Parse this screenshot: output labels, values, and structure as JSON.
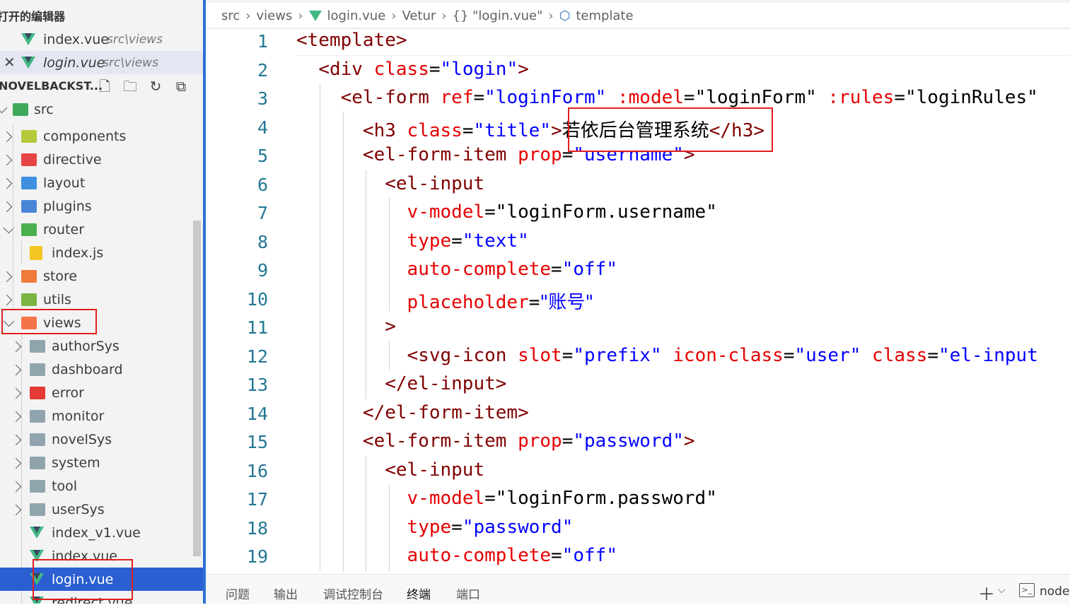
{
  "sidebar": {
    "open_editors_title": "打开的编辑器",
    "open_editors": [
      {
        "name": "index.vue",
        "path": "src\\views"
      },
      {
        "name": "login.vue",
        "path": "src\\views"
      }
    ],
    "project_title": "NOVELBACKST...",
    "toolbar_icons": [
      "new-file-icon",
      "new-folder-icon",
      "refresh-icon",
      "collapse-all-icon"
    ],
    "tree": [
      {
        "label": "src",
        "icon": "folder-src-icon",
        "expanded": true
      },
      {
        "label": "components",
        "icon": "folder-components-icon",
        "expanded": false
      },
      {
        "label": "directive",
        "icon": "folder-directive-icon",
        "expanded": false
      },
      {
        "label": "layout",
        "icon": "folder-layout-icon",
        "expanded": false
      },
      {
        "label": "plugins",
        "icon": "folder-plugins-icon",
        "expanded": false
      },
      {
        "label": "router",
        "icon": "folder-router-icon",
        "expanded": true
      },
      {
        "label": "index.js",
        "icon": "js-file-icon"
      },
      {
        "label": "store",
        "icon": "folder-store-icon",
        "expanded": false
      },
      {
        "label": "utils",
        "icon": "folder-utils-icon",
        "expanded": false
      },
      {
        "label": "views",
        "icon": "folder-views-icon",
        "expanded": true
      },
      {
        "label": "authorSys",
        "icon": "folder-icon",
        "expanded": false
      },
      {
        "label": "dashboard",
        "icon": "folder-icon",
        "expanded": false
      },
      {
        "label": "error",
        "icon": "folder-error-icon",
        "expanded": false
      },
      {
        "label": "monitor",
        "icon": "folder-icon",
        "expanded": false
      },
      {
        "label": "novelSys",
        "icon": "folder-icon",
        "expanded": false
      },
      {
        "label": "system",
        "icon": "folder-icon",
        "expanded": false
      },
      {
        "label": "tool",
        "icon": "folder-icon",
        "expanded": false
      },
      {
        "label": "userSys",
        "icon": "folder-icon",
        "expanded": false
      },
      {
        "label": "index_v1.vue",
        "icon": "vue-file-icon"
      },
      {
        "label": "index.vue",
        "icon": "vue-file-icon"
      },
      {
        "label": "login.vue",
        "icon": "vue-file-icon",
        "selected": true
      },
      {
        "label": "redirect.vue",
        "icon": "vue-file-icon"
      }
    ]
  },
  "breadcrumb": [
    "src",
    "views",
    "login.vue",
    "Vetur",
    "{} \"login.vue\"",
    "template"
  ],
  "code_lines": [
    {
      "n": "1",
      "tokens": [
        {
          "t": "<template>",
          "c": "tag"
        }
      ]
    },
    {
      "n": "2",
      "tokens": [
        {
          "t": "  "
        },
        {
          "t": "<div ",
          "c": "tag"
        },
        {
          "t": "class",
          "c": "attr"
        },
        {
          "t": "=",
          "c": "plain"
        },
        {
          "t": "\"login\"",
          "c": "str"
        },
        {
          "t": ">",
          "c": "tag"
        }
      ]
    },
    {
      "n": "3",
      "tokens": [
        {
          "t": "    "
        },
        {
          "t": "<el-form ",
          "c": "tag"
        },
        {
          "t": "ref",
          "c": "attr"
        },
        {
          "t": "=",
          "c": "plain"
        },
        {
          "t": "\"loginForm\"",
          "c": "str"
        },
        {
          "t": " "
        },
        {
          "t": ":model",
          "c": "attr"
        },
        {
          "t": "=",
          "c": "plain"
        },
        {
          "t": "\"loginForm\"",
          "c": "plain"
        },
        {
          "t": " "
        },
        {
          "t": ":rules",
          "c": "attr"
        },
        {
          "t": "=",
          "c": "plain"
        },
        {
          "t": "\"loginRules\"",
          "c": "plain"
        }
      ]
    },
    {
      "n": "4",
      "tokens": [
        {
          "t": "      "
        },
        {
          "t": "<h3 ",
          "c": "tag"
        },
        {
          "t": "class",
          "c": "attr"
        },
        {
          "t": "=",
          "c": "plain"
        },
        {
          "t": "\"title\"",
          "c": "str"
        },
        {
          "t": ">",
          "c": "tag"
        },
        {
          "t": "若依后台管理系统",
          "c": "plain",
          "cjk": true
        },
        {
          "t": "</h3>",
          "c": "tag"
        }
      ]
    },
    {
      "n": "5",
      "tokens": [
        {
          "t": "      "
        },
        {
          "t": "<el-form-item ",
          "c": "tag"
        },
        {
          "t": "prop",
          "c": "attr"
        },
        {
          "t": "=",
          "c": "plain"
        },
        {
          "t": "\"username\"",
          "c": "str"
        },
        {
          "t": ">",
          "c": "tag"
        }
      ]
    },
    {
      "n": "6",
      "tokens": [
        {
          "t": "        "
        },
        {
          "t": "<el-input",
          "c": "tag"
        }
      ]
    },
    {
      "n": "7",
      "tokens": [
        {
          "t": "          "
        },
        {
          "t": "v-model",
          "c": "attr"
        },
        {
          "t": "=",
          "c": "plain"
        },
        {
          "t": "\"loginForm.username\"",
          "c": "plain"
        }
      ]
    },
    {
      "n": "8",
      "tokens": [
        {
          "t": "          "
        },
        {
          "t": "type",
          "c": "attr"
        },
        {
          "t": "=",
          "c": "plain"
        },
        {
          "t": "\"text\"",
          "c": "str"
        }
      ]
    },
    {
      "n": "9",
      "tokens": [
        {
          "t": "          "
        },
        {
          "t": "auto-complete",
          "c": "attr"
        },
        {
          "t": "=",
          "c": "plain"
        },
        {
          "t": "\"off\"",
          "c": "str"
        }
      ]
    },
    {
      "n": "10",
      "tokens": [
        {
          "t": "          "
        },
        {
          "t": "placeholder",
          "c": "attr"
        },
        {
          "t": "=",
          "c": "plain"
        },
        {
          "t": "\"账号\"",
          "c": "str",
          "cjk": true
        }
      ]
    },
    {
      "n": "11",
      "tokens": [
        {
          "t": "        "
        },
        {
          "t": ">",
          "c": "tag"
        }
      ]
    },
    {
      "n": "12",
      "tokens": [
        {
          "t": "          "
        },
        {
          "t": "<svg-icon ",
          "c": "tag"
        },
        {
          "t": "slot",
          "c": "attr"
        },
        {
          "t": "=",
          "c": "plain"
        },
        {
          "t": "\"prefix\"",
          "c": "str"
        },
        {
          "t": " "
        },
        {
          "t": "icon-class",
          "c": "attr"
        },
        {
          "t": "=",
          "c": "plain"
        },
        {
          "t": "\"user\"",
          "c": "str"
        },
        {
          "t": " "
        },
        {
          "t": "class",
          "c": "attr"
        },
        {
          "t": "=",
          "c": "plain"
        },
        {
          "t": "\"el-input",
          "c": "str"
        }
      ]
    },
    {
      "n": "13",
      "tokens": [
        {
          "t": "        "
        },
        {
          "t": "</el-input>",
          "c": "tag"
        }
      ]
    },
    {
      "n": "14",
      "tokens": [
        {
          "t": "      "
        },
        {
          "t": "</el-form-item>",
          "c": "tag"
        }
      ]
    },
    {
      "n": "15",
      "tokens": [
        {
          "t": "      "
        },
        {
          "t": "<el-form-item ",
          "c": "tag"
        },
        {
          "t": "prop",
          "c": "attr"
        },
        {
          "t": "=",
          "c": "plain"
        },
        {
          "t": "\"password\"",
          "c": "str"
        },
        {
          "t": ">",
          "c": "tag"
        }
      ]
    },
    {
      "n": "16",
      "tokens": [
        {
          "t": "        "
        },
        {
          "t": "<el-input",
          "c": "tag"
        }
      ]
    },
    {
      "n": "17",
      "tokens": [
        {
          "t": "          "
        },
        {
          "t": "v-model",
          "c": "attr"
        },
        {
          "t": "=",
          "c": "plain"
        },
        {
          "t": "\"loginForm.password\"",
          "c": "plain"
        }
      ]
    },
    {
      "n": "18",
      "tokens": [
        {
          "t": "          "
        },
        {
          "t": "type",
          "c": "attr"
        },
        {
          "t": "=",
          "c": "plain"
        },
        {
          "t": "\"password\"",
          "c": "str"
        }
      ]
    },
    {
      "n": "19",
      "tokens": [
        {
          "t": "          "
        },
        {
          "t": "auto-complete",
          "c": "attr"
        },
        {
          "t": "=",
          "c": "plain"
        },
        {
          "t": "\"off\"",
          "c": "str"
        }
      ]
    }
  ],
  "panel": {
    "tabs": [
      "问题",
      "输出",
      "调试控制台",
      "终端",
      "端口"
    ],
    "active_tab": "终端",
    "add_icon": "＋",
    "terminal_label": "node"
  },
  "colors": {
    "accent": "#2b5fd1",
    "tag": "#800000",
    "attr": "#e50000",
    "string": "#0000ff",
    "line_number": "#237893",
    "annotation": "#e11e1e"
  }
}
